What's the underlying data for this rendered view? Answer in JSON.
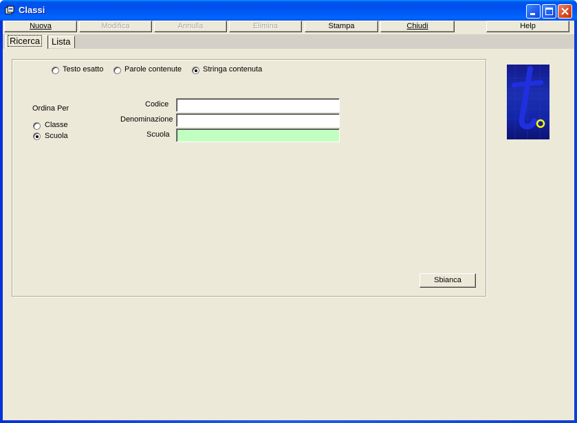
{
  "window": {
    "title": "Classi"
  },
  "toolbar": {
    "nuova": "Nuova",
    "modifica": "Modifica",
    "annulla": "Annulla",
    "elimina": "Elimina",
    "stampa": "Stampa",
    "chiudi": "Chiudi",
    "help": "Help"
  },
  "tabs": {
    "ricerca": "Ricerca",
    "lista": "Lista"
  },
  "search_mode": {
    "testo_esatto": "Testo esatto",
    "parole_contenute": "Parole contenute",
    "stringa_contenuta": "Stringa contenuta",
    "selected": "Stringa contenuta"
  },
  "sort": {
    "title": "Ordina Per",
    "classe": "Classe",
    "scuola": "Scuola",
    "selected": "Scuola"
  },
  "fields": {
    "codice_label": "Codice",
    "codice_value": "",
    "denominazione_label": "Denominazione",
    "denominazione_value": "",
    "scuola_label": "Scuola",
    "scuola_value": ""
  },
  "buttons": {
    "sbianca": "Sbianca"
  },
  "colors": {
    "scuola_field_bg": "#c0ffc0",
    "logo_letter": "#1f2fe0",
    "logo_accent": "#ffff00"
  }
}
